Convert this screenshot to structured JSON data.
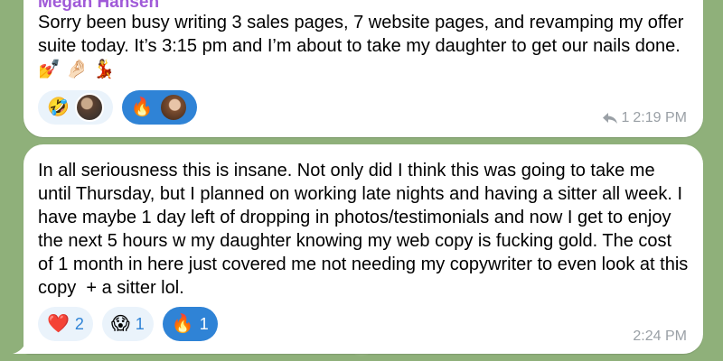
{
  "chat": {
    "messages": [
      {
        "sender": "Megan Hansen",
        "text": "Sorry been busy writing 3 sales pages, 7 website pages, and revamping my offer suite today. It’s 3:15 pm and I’m about to take my daughter to get our nails done. 💅 🤌🏻 💃",
        "reactions": [
          {
            "emoji": "🤣",
            "count": "",
            "active": false,
            "avatar": "reactor-avatar"
          },
          {
            "emoji": "🔥",
            "count": "",
            "active": true,
            "avatar": "reactor-avatar"
          }
        ],
        "reply_count": "1",
        "time": "2:19 PM"
      },
      {
        "sender": "",
        "text": "In all seriousness this is insane. Not only did I think this was going to take me until Thursday, but I planned on working late nights and having a sitter all week. I have maybe 1 day left of dropping in photos/testimonials and now I get to enjoy the next 5 hours w my daughter knowing my web copy is fucking gold. The cost of 1 month in here just covered me not needing my copywriter to even look at this copy  + a sitter lol.",
        "reactions": [
          {
            "emoji": "❤️",
            "count": "2",
            "active": false
          },
          {
            "emoji": "😱",
            "count": "1",
            "active": false
          },
          {
            "emoji": "🔥",
            "count": "1",
            "active": true
          }
        ],
        "time": "2:24 PM"
      }
    ]
  },
  "colors": {
    "background": "#8fb07a",
    "bubble": "#ffffff",
    "accent": "#2f83d6",
    "sender_name": "#a05ad8",
    "meta_text": "#9aa0a6"
  },
  "icons": {
    "reply": "reply-arrow-icon"
  }
}
